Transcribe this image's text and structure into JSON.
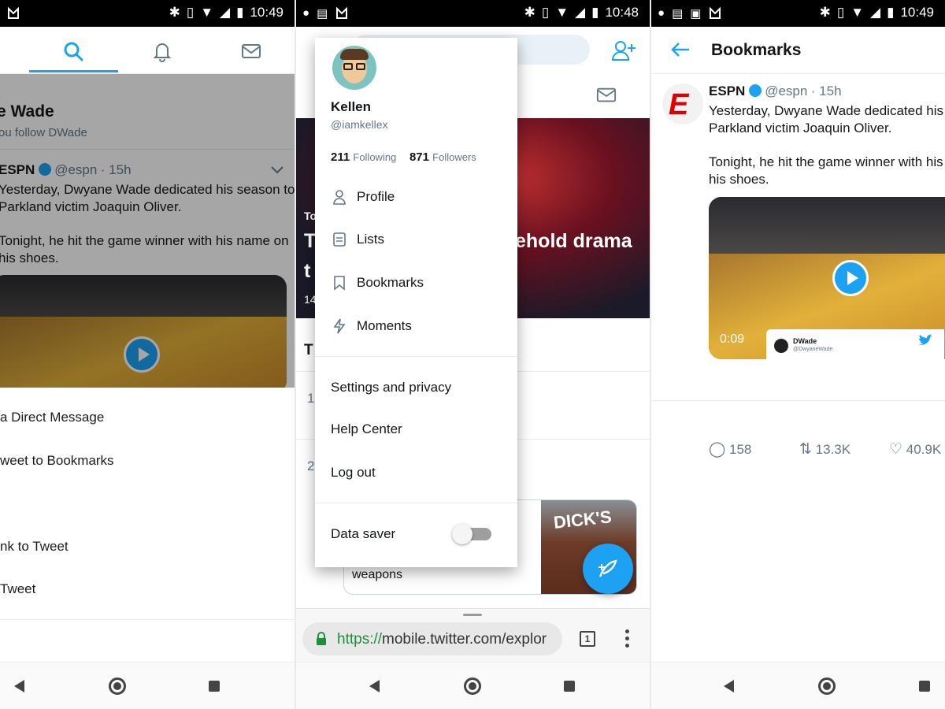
{
  "status_bar": {
    "time_left": "10:49",
    "time_middle": "10:48",
    "time_right": "10:49",
    "battery_icon": "battery-icon",
    "wifi_icon": "wifi-icon"
  },
  "colors": {
    "brand": "#1da1f2",
    "text": "#14171a",
    "muted": "#657786",
    "espn_red": "#dd0000"
  },
  "panel1": {
    "tabs": [
      {
        "icon": "search-icon",
        "active": true
      },
      {
        "icon": "bell-icon",
        "active": false
      },
      {
        "icon": "mail-icon",
        "active": false
      }
    ],
    "header_name": "e Wade",
    "header_sub": "ou follow DWade",
    "tweet": {
      "author": "ESPN",
      "handle": "@espn",
      "time": "· 15h",
      "text_1": "Yesterday, Dwyane Wade dedicated his season to",
      "text_2": "Parkland victim Joaquin Oliver.",
      "text_3": "Tonight, he hit the game winner with his name on",
      "text_4": "his shoes."
    },
    "sheet_items": [
      "a Direct Message",
      "weet to Bookmarks",
      "nk to Tweet",
      "Tweet"
    ]
  },
  "panel2": {
    "profile": {
      "name": "Kellen",
      "handle": "@iamkellex",
      "following_count": "211",
      "following_label": "Following",
      "followers_count": "871",
      "followers_label": "Followers"
    },
    "menu": [
      "Profile",
      "Lists",
      "Bookmarks",
      "Moments"
    ],
    "menu2": [
      "Settings and privacy",
      "Help Center",
      "Log out"
    ],
    "data_saver": {
      "label": "Data saver",
      "enabled": false
    },
    "hero_text_1": "ehold drama",
    "hero_text_2": "T",
    "hero_text_3": "t",
    "hero_small": "To",
    "hero_num": "14",
    "trend_label": "T",
    "trend_1": "1",
    "trend_2": "2",
    "card_text": "weapons",
    "card_brand": "DICK'S",
    "url_scheme": "https://",
    "url_host": "mobile.twitter.com/explor",
    "tab_count": "1"
  },
  "panel3": {
    "title": "Bookmarks",
    "tweet": {
      "author": "ESPN",
      "handle": "@espn",
      "time": "· 15h",
      "text_1": "Yesterday, Dwyane Wade dedicated his s",
      "text_2": "Parkland victim Joaquin Oliver.",
      "text_3": "Tonight, he hit the game winner with his r",
      "text_4": "his shoes."
    },
    "video_time": "0:09",
    "embed_name": "DWade",
    "embed_handle": "@DwyaneWade",
    "replies": "158",
    "retweets": "13.3K",
    "likes": "40.9K"
  }
}
